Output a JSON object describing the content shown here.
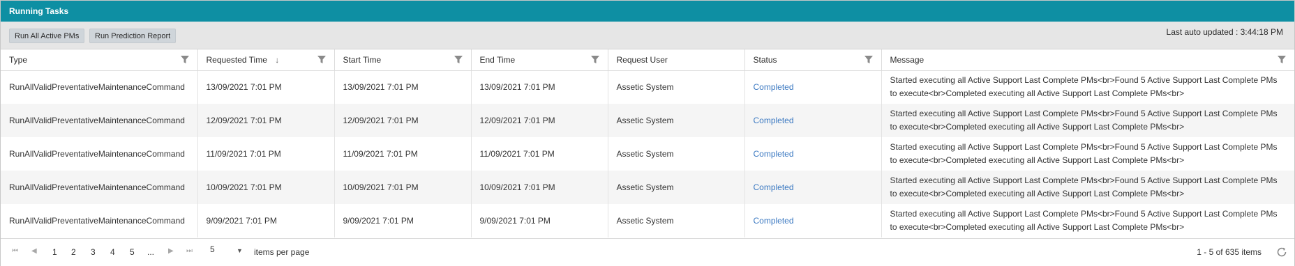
{
  "panel": {
    "title": "Running Tasks"
  },
  "toolbar": {
    "run_all_label": "Run All Active PMs",
    "run_prediction_label": "Run Prediction Report",
    "last_updated": "Last auto updated : 3:44:18 PM"
  },
  "grid": {
    "columns": {
      "type": "Type",
      "requested_time": "Requested Time",
      "start_time": "Start Time",
      "end_time": "End Time",
      "request_user": "Request User",
      "status": "Status",
      "message": "Message"
    },
    "sort": {
      "column": "Requested Time",
      "direction": "descending",
      "icon": "arrow-down-icon"
    },
    "rows": [
      {
        "type": "RunAllValidPreventativeMaintenanceCommand",
        "requested_time": "13/09/2021 7:01 PM",
        "start_time": "13/09/2021 7:01 PM",
        "end_time": "13/09/2021 7:01 PM",
        "request_user": "Assetic System",
        "status": "Completed",
        "message": "Started executing all Active Support Last Complete PMs<br>Found 5 Active Support Last Complete PMs to execute<br>Completed executing all Active Support Last Complete PMs<br>"
      },
      {
        "type": "RunAllValidPreventativeMaintenanceCommand",
        "requested_time": "12/09/2021 7:01 PM",
        "start_time": "12/09/2021 7:01 PM",
        "end_time": "12/09/2021 7:01 PM",
        "request_user": "Assetic System",
        "status": "Completed",
        "message": "Started executing all Active Support Last Complete PMs<br>Found 5 Active Support Last Complete PMs to execute<br>Completed executing all Active Support Last Complete PMs<br>"
      },
      {
        "type": "RunAllValidPreventativeMaintenanceCommand",
        "requested_time": "11/09/2021 7:01 PM",
        "start_time": "11/09/2021 7:01 PM",
        "end_time": "11/09/2021 7:01 PM",
        "request_user": "Assetic System",
        "status": "Completed",
        "message": "Started executing all Active Support Last Complete PMs<br>Found 5 Active Support Last Complete PMs to execute<br>Completed executing all Active Support Last Complete PMs<br>"
      },
      {
        "type": "RunAllValidPreventativeMaintenanceCommand",
        "requested_time": "10/09/2021 7:01 PM",
        "start_time": "10/09/2021 7:01 PM",
        "end_time": "10/09/2021 7:01 PM",
        "request_user": "Assetic System",
        "status": "Completed",
        "message": "Started executing all Active Support Last Complete PMs<br>Found 5 Active Support Last Complete PMs to execute<br>Completed executing all Active Support Last Complete PMs<br>"
      },
      {
        "type": "RunAllValidPreventativeMaintenanceCommand",
        "requested_time": "9/09/2021 7:01 PM",
        "start_time": "9/09/2021 7:01 PM",
        "end_time": "9/09/2021 7:01 PM",
        "request_user": "Assetic System",
        "status": "Completed",
        "message": "Started executing all Active Support Last Complete PMs<br>Found 5 Active Support Last Complete PMs to execute<br>Completed executing all Active Support Last Complete PMs<br>"
      }
    ]
  },
  "pager": {
    "pages": [
      "1",
      "2",
      "3",
      "4",
      "5",
      "..."
    ],
    "page_size": "5",
    "items_per_page_label": "items per page",
    "info": "1 - 5 of 635 items"
  },
  "colors": {
    "title_bar": "#0e8fa3",
    "status_link": "#3a78c1",
    "toolbar_bg": "#e6e6e6"
  }
}
